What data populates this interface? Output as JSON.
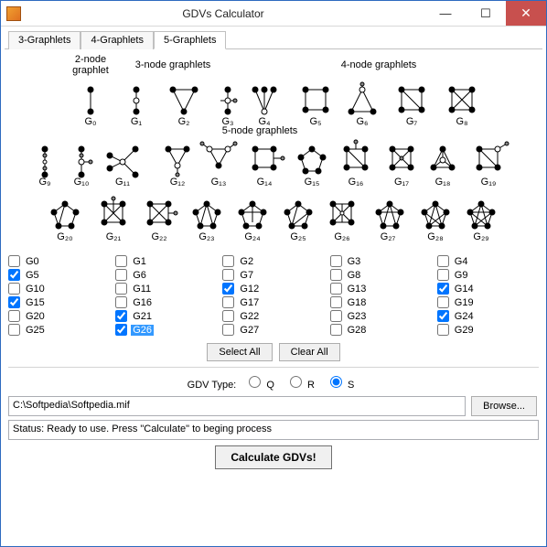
{
  "title": "GDVs Calculator",
  "tabs": [
    {
      "label": "3-Graphlets",
      "active": false
    },
    {
      "label": "4-Graphlets",
      "active": false
    },
    {
      "label": "5-Graphlets",
      "active": true
    }
  ],
  "diagram_headers": {
    "h2": "2-node\ngraphlet",
    "h3": "3-node graphlets",
    "h4": "4-node graphlets",
    "h5": "5-node graphlets"
  },
  "graphlet_labels": [
    "G₀",
    "G₁",
    "G₂",
    "G₃",
    "G₄",
    "G₅",
    "G₆",
    "G₇",
    "G₈",
    "G₉",
    "G₁₀",
    "G₁₁",
    "G₁₂",
    "G₁₃",
    "G₁₄",
    "G₁₅",
    "G₁₆",
    "G₁₇",
    "G₁₈",
    "G₁₉",
    "G₂₀",
    "G₂₁",
    "G₂₂",
    "G₂₃",
    "G₂₄",
    "G₂₅",
    "G₂₆",
    "G₂₇",
    "G₂₈",
    "G₂₉"
  ],
  "checkboxes": [
    {
      "key": "G0",
      "label": "G0",
      "checked": false,
      "selected": false
    },
    {
      "key": "G1",
      "label": "G1",
      "checked": false,
      "selected": false
    },
    {
      "key": "G2",
      "label": "G2",
      "checked": false,
      "selected": false
    },
    {
      "key": "G3",
      "label": "G3",
      "checked": false,
      "selected": false
    },
    {
      "key": "G4",
      "label": "G4",
      "checked": false,
      "selected": false
    },
    {
      "key": "G5",
      "label": "G5",
      "checked": true,
      "selected": false
    },
    {
      "key": "G6",
      "label": "G6",
      "checked": false,
      "selected": false
    },
    {
      "key": "G7",
      "label": "G7",
      "checked": false,
      "selected": false
    },
    {
      "key": "G8",
      "label": "G8",
      "checked": false,
      "selected": false
    },
    {
      "key": "G9",
      "label": "G9",
      "checked": false,
      "selected": false
    },
    {
      "key": "G10",
      "label": "G10",
      "checked": false,
      "selected": false
    },
    {
      "key": "G11",
      "label": "G11",
      "checked": false,
      "selected": false
    },
    {
      "key": "G12",
      "label": "G12",
      "checked": true,
      "selected": false
    },
    {
      "key": "G13",
      "label": "G13",
      "checked": false,
      "selected": false
    },
    {
      "key": "G14",
      "label": "G14",
      "checked": true,
      "selected": false
    },
    {
      "key": "G15",
      "label": "G15",
      "checked": true,
      "selected": false
    },
    {
      "key": "G16",
      "label": "G16",
      "checked": false,
      "selected": false
    },
    {
      "key": "G17",
      "label": "G17",
      "checked": false,
      "selected": false
    },
    {
      "key": "G18",
      "label": "G18",
      "checked": false,
      "selected": false
    },
    {
      "key": "G19",
      "label": "G19",
      "checked": false,
      "selected": false
    },
    {
      "key": "G20",
      "label": "G20",
      "checked": false,
      "selected": false
    },
    {
      "key": "G21",
      "label": "G21",
      "checked": true,
      "selected": false
    },
    {
      "key": "G22",
      "label": "G22",
      "checked": false,
      "selected": false
    },
    {
      "key": "G23",
      "label": "G23",
      "checked": false,
      "selected": false
    },
    {
      "key": "G24",
      "label": "G24",
      "checked": true,
      "selected": false
    },
    {
      "key": "G25",
      "label": "G25",
      "checked": false,
      "selected": false
    },
    {
      "key": "G26",
      "label": "G26",
      "checked": true,
      "selected": true
    },
    {
      "key": "G27",
      "label": "G27",
      "checked": false,
      "selected": false
    },
    {
      "key": "G28",
      "label": "G28",
      "checked": false,
      "selected": false
    },
    {
      "key": "G29",
      "label": "G29",
      "checked": false,
      "selected": false
    }
  ],
  "buttons": {
    "select_all": "Select All",
    "clear_all": "Clear All",
    "browse": "Browse...",
    "calculate": "Calculate GDVs!"
  },
  "gdv_type": {
    "label": "GDV Type:",
    "options": [
      {
        "key": "Q",
        "label": "Q",
        "checked": false
      },
      {
        "key": "R",
        "label": "R",
        "checked": false
      },
      {
        "key": "S",
        "label": "S",
        "checked": true
      }
    ]
  },
  "path": "C:\\Softpedia\\Softpedia.mif",
  "status": "Status: Ready to use.   Press \"Calculate\" to beging process"
}
